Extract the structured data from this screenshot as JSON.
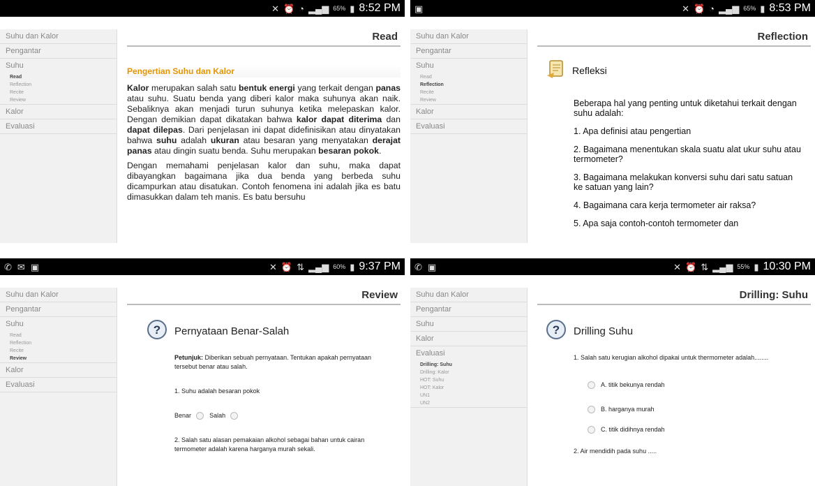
{
  "panels": [
    {
      "status": {
        "time": "8:52 PM",
        "battery": "65%"
      },
      "sidebar": [
        "Suhu dan Kalor",
        "Pengantar",
        "Suhu"
      ],
      "sub": [
        "Read",
        "Reflection",
        "Recite",
        "Review"
      ],
      "sidebar_after": [
        "Kalor",
        "Evaluasi"
      ],
      "header": "Read",
      "title": "Pengertian Suhu dan Kalor",
      "para1_parts": [
        {
          "t": "Kalor",
          "b": true
        },
        {
          "t": " merupakan salah satu ",
          "b": false
        },
        {
          "t": "bentuk energi",
          "b": true
        },
        {
          "t": " yang terkait dengan ",
          "b": false
        },
        {
          "t": "panas",
          "b": true
        },
        {
          "t": " atau suhu. Suatu benda yang diberi kalor maka suhunya akan naik. Sebaliknya akan menjadi turun suhunya ketika melepaskan kalor. Dengan demikian dapat dikatakan bahwa ",
          "b": false
        },
        {
          "t": "kalor dapat diterima",
          "b": true
        },
        {
          "t": " dan ",
          "b": false
        },
        {
          "t": "dapat dilepas",
          "b": true
        },
        {
          "t": ". Dari penjelasan ini dapat didefinisikan atau dinyatakan bahwa ",
          "b": false
        },
        {
          "t": "suhu",
          "b": true
        },
        {
          "t": " adalah ",
          "b": false
        },
        {
          "t": "ukuran",
          "b": true
        },
        {
          "t": " atau besaran yang menyatakan ",
          "b": false
        },
        {
          "t": "derajat panas",
          "b": true
        },
        {
          "t": " atau dingin suatu benda. Suhu merupakan ",
          "b": false
        },
        {
          "t": "besaran pokok",
          "b": true
        },
        {
          "t": ".",
          "b": false
        }
      ],
      "para2": "Dengan memahami penjelasan kalor dan suhu, maka dapat dibayangkan bagaimana jika dua benda yang berbeda suhu dicampurkan atau disatukan. Contoh fenomena ini adalah jika es batu dimasukkan dalam teh manis. Es batu bersuhu"
    },
    {
      "status": {
        "time": "8:53 PM",
        "battery": "65%"
      },
      "sidebar": [
        "Suhu dan Kalor",
        "Pengantar",
        "Suhu"
      ],
      "sub": [
        "Read",
        "Reflection",
        "Recite",
        "Review"
      ],
      "sidebar_after": [
        "Kalor",
        "Evaluasi"
      ],
      "header": "Reflection",
      "title": "Refleksi",
      "lines": [
        "Beberapa hal yang penting untuk diketahui terkait dengan suhu adalah:",
        "1. Apa definisi atau pengertian",
        "2. Bagaimana menentukan skala suatu alat ukur suhu atau termometer?",
        "3. Bagaimana melakukan konversi suhu dari satu satuan ke satuan yang lain?",
        "4. Bagaimana cara kerja termometer air raksa?",
        "5. Apa saja contoh-contoh termometer dan"
      ]
    },
    {
      "status": {
        "time": "9:37 PM",
        "battery": "60%"
      },
      "sidebar": [
        "Suhu dan Kalor",
        "Pengantar",
        "Suhu"
      ],
      "sub": [
        "Read",
        "Reflection",
        "Recite",
        "Review"
      ],
      "sidebar_after": [
        "Kalor",
        "Evaluasi"
      ],
      "header": "Review",
      "title": "Pernyataan Benar-Salah",
      "instr_bold": "Petunjuk:",
      "instr": " Diberikan sebuah pernyataan. Tentukan apakah pernyataan tersebut benar atau salah.",
      "q1": "1. Suhu adalah besaran pokok",
      "opt_true": "Benar",
      "opt_false": "Salah",
      "q2": "2. Salah satu alasan pemakaian alkohol sebagai bahan untuk cairan termometer adalah karena harganya murah sekali."
    },
    {
      "status": {
        "time": "10:30 PM",
        "battery": "55%"
      },
      "sidebar": [
        "Suhu dan Kalor",
        "Pengantar",
        "Suhu",
        "Kalor",
        "Evaluasi"
      ],
      "sub": [
        "Drilling: Suhu",
        "Drilling: Kalor",
        "HOT: Suhu",
        "HOT: Kalor",
        "UN1",
        "UN2"
      ],
      "sidebar_after": [],
      "header": "Drilling: Suhu",
      "title": "Drilling Suhu",
      "q1": "1. Salah satu kerugian alkohol dipakai untuk thermometer adalah........",
      "options": [
        "A. titik bekunya rendah",
        "B. harganya murah",
        "C. titik didihnya rendah"
      ],
      "q2": "2. Air mendidih pada suhu ....."
    }
  ],
  "active_sub": [
    "Read",
    "Reflection",
    "Review",
    "Drilling: Suhu"
  ]
}
